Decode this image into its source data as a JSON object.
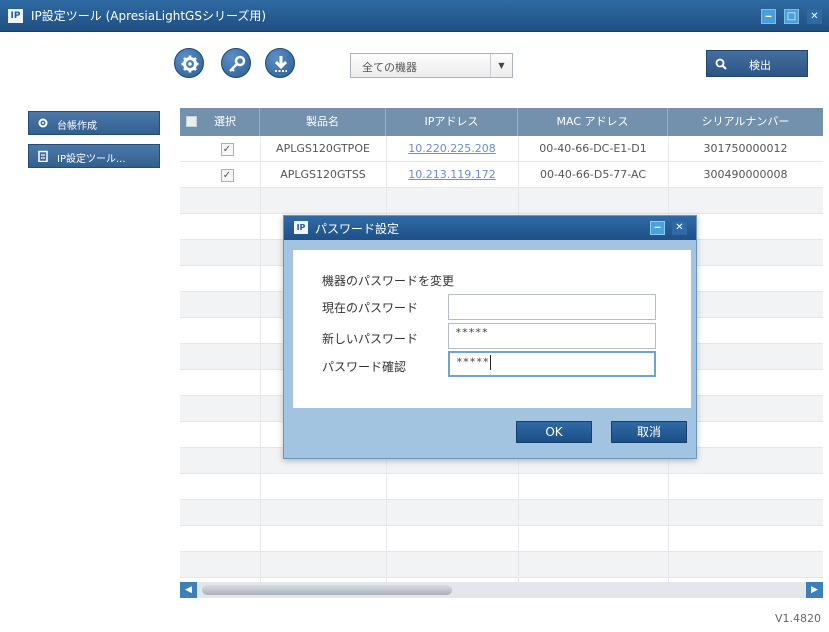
{
  "app": {
    "title": "IP設定ツール (ApresiaLightGSシリーズ用)",
    "logo_text": "IP",
    "version": "V1.4820"
  },
  "window_controls": {
    "minimize": "‒",
    "maximize": "□",
    "close": "✕"
  },
  "toolbar": {
    "icons": [
      "gear-icon",
      "key-icon",
      "download-icon"
    ],
    "filter_value": "全ての機器",
    "detect_label": "検出"
  },
  "sidebar": {
    "items": [
      {
        "label": "台帳作成",
        "icon": "gear-icon"
      },
      {
        "label": "IP設定ツール...",
        "icon": "clipboard-icon"
      }
    ]
  },
  "table": {
    "columns": [
      "選択",
      "製品名",
      "IPアドレス",
      "MAC アドレス",
      "シリアルナンバー"
    ],
    "rows": [
      {
        "checked": "✓",
        "product": "APLGS120GTPOE",
        "ip": "10.220.225.208",
        "mac": "00-40-66-DC-E1-D1",
        "serial": "301750000012"
      },
      {
        "checked": "✓",
        "product": "APLGS120GTSS",
        "ip": "10.213.119.172",
        "mac": "00-40-66-D5-77-AC",
        "serial": "300490000008"
      }
    ]
  },
  "dialog": {
    "logo_text": "IP",
    "title": "パスワード設定",
    "heading": "機器のパスワードを変更",
    "current_password_label": "現在のパスワード",
    "current_password_value": "",
    "new_password_label": "新しいパスワード",
    "new_password_value": "*****",
    "confirm_label": "パスワード確認",
    "confirm_value": "*****",
    "ok_label": "OK",
    "cancel_label": "取消"
  },
  "colors": {
    "title_bar": "#2a5d93",
    "header": "#7391ad",
    "dialog_frame": "#a2c4e1",
    "link": "#6e8bd6"
  }
}
